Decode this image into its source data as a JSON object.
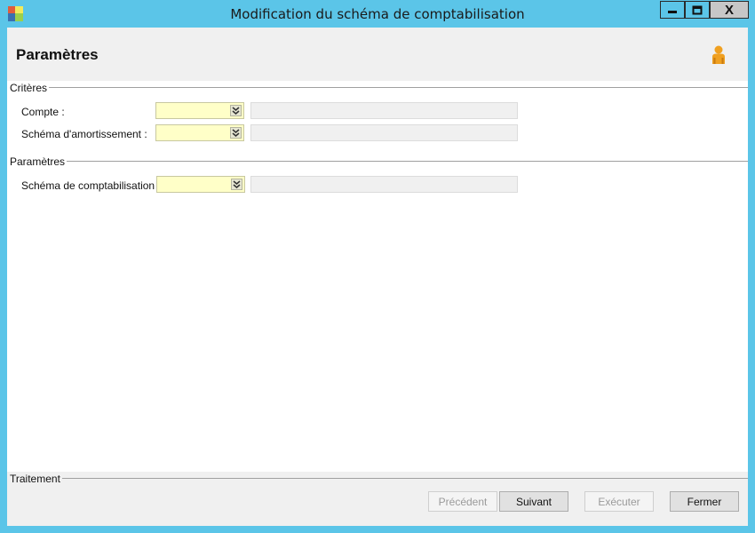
{
  "window": {
    "title": "Modification du schéma de comptabilisation",
    "close_glyph": "X"
  },
  "header": {
    "title": "Paramètres",
    "icon": "user-icon"
  },
  "criteres": {
    "title": "Critères",
    "fields": [
      {
        "label": "Compte :",
        "value": "",
        "description": ""
      },
      {
        "label": "Schéma d'amortissement :",
        "value": "",
        "description": ""
      }
    ]
  },
  "parametres": {
    "title": "Paramètres",
    "fields": [
      {
        "label": "Schéma de comptabilisation :",
        "value": "",
        "description": ""
      }
    ]
  },
  "traitement": {
    "title": "Traitement",
    "buttons": {
      "precedent": "Précédent",
      "suivant": "Suivant",
      "executer": "Exécuter",
      "fermer": "Fermer"
    }
  },
  "colors": {
    "titlebar": "#5bc5e8",
    "combo_background": "#ffffc8",
    "user_icon": "#f0a020"
  }
}
